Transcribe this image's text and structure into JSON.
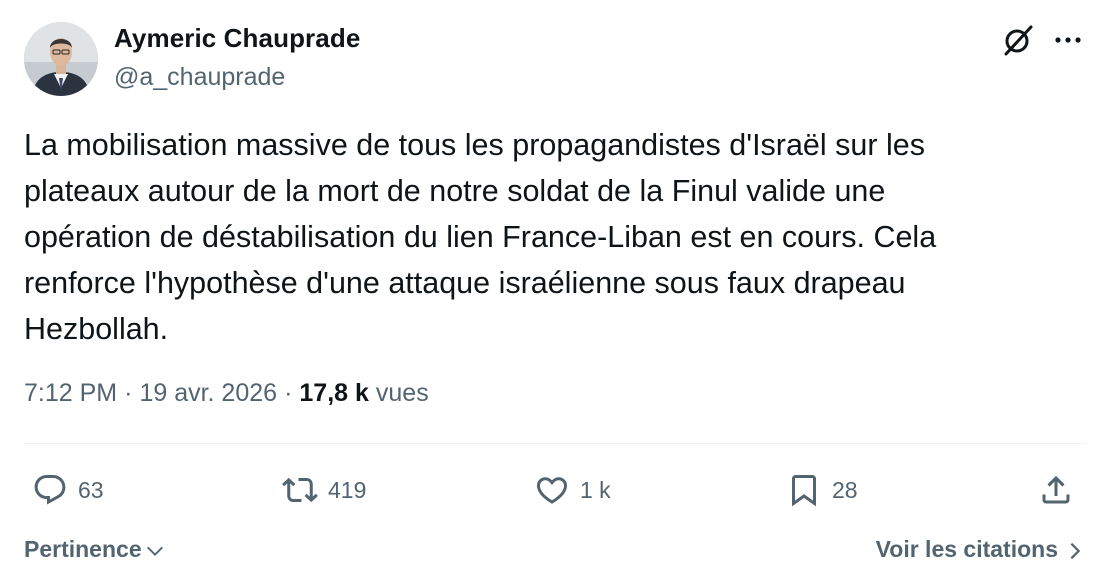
{
  "author": {
    "name": "Aymeric Chauprade",
    "handle": "@a_chauprade",
    "avatar_icon": "profile-photo"
  },
  "header_icons": {
    "grok": "grok-icon",
    "more": "more-icon"
  },
  "tweet": {
    "text": "La mobilisation massive de tous les propagandistes d'Israël sur les\nplateaux autour de la mort de notre soldat de la Finul valide une\nopération de déstabilisation du lien France-Liban est en cours. Cela\nrenforce l'hypothèse d'une attaque israélienne sous faux drapeau\nHezbollah."
  },
  "meta": {
    "time": "7:12 PM",
    "separator": "·",
    "date": "19 avr. 2026",
    "views_count": "17,8 k",
    "views_label": "vues"
  },
  "actions": {
    "reply": {
      "icon": "reply-icon",
      "count": "63"
    },
    "retweet": {
      "icon": "retweet-icon",
      "count": "419"
    },
    "like": {
      "icon": "heart-icon",
      "count": "1 k"
    },
    "bookmark": {
      "icon": "bookmark-icon",
      "count": "28"
    },
    "share": {
      "icon": "share-icon"
    }
  },
  "footer": {
    "sort_label": "Pertinence",
    "quotes_label": "Voir les citations"
  },
  "colors": {
    "text_primary": "#0f1419",
    "text_secondary": "#536471",
    "divider": "#eff3f4"
  }
}
